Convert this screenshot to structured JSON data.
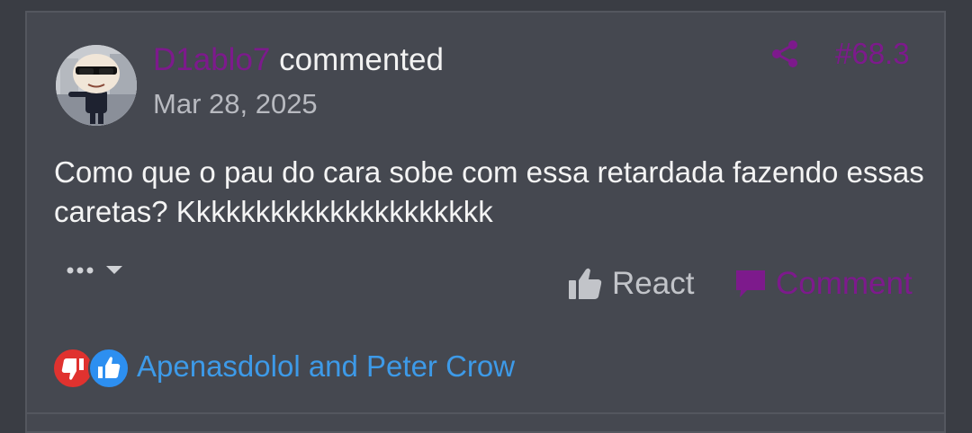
{
  "post": {
    "author": "D1ablo7",
    "action": "commented",
    "date": "Mar 28, 2025",
    "number": "#68.3",
    "body": "Como que o pau do cara sobe com essa retardada fazendo essas caretas? Kkkkkkkkkkkkkkkkkkkkk"
  },
  "actions": {
    "react_label": "React",
    "comment_label": "Comment"
  },
  "reactions": {
    "names": "Apenasdolol and Peter Crow",
    "icons": [
      "thumbs-down-icon",
      "thumbs-up-icon"
    ]
  },
  "colors": {
    "accent": "#7d1a8c",
    "link": "#3d9ae8",
    "background": "#454850",
    "dislike": "#e0322f",
    "like": "#2d8ff0"
  }
}
